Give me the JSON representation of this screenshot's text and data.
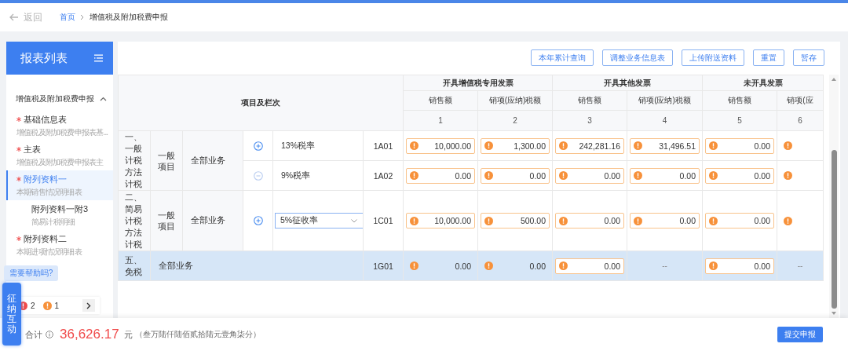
{
  "header": {
    "back": "返回",
    "breadcrumb": [
      {
        "label": "首页",
        "link": true
      },
      {
        "label": "增值税及附加税费申报",
        "link": false
      }
    ]
  },
  "sidebar": {
    "title": "报表列表",
    "group": {
      "label": "增值税及附加税费申报",
      "expanded": true,
      "items": [
        {
          "title": "基础信息表",
          "subtitle": "增值税及附加税费申报表基...",
          "required": true,
          "selected": false
        },
        {
          "title": "主表",
          "subtitle": "增值税及附加税费申报表主",
          "required": true,
          "selected": false
        },
        {
          "title": "附列资料一",
          "subtitle": "本期销售情况明细表",
          "required": true,
          "selected": true,
          "children": [
            {
              "title": "附列资料一附3",
              "subtitle": "简易计税明细",
              "required": false,
              "selected": false
            }
          ]
        },
        {
          "title": "附列资料二",
          "subtitle": "本期进项情况明细表",
          "required": true,
          "selected": false
        }
      ]
    }
  },
  "toolbar": {
    "buttons": [
      "本年累计查询",
      "调整业务信息表",
      "上传附送资料",
      "重置",
      "暂存"
    ]
  },
  "table": {
    "stub_header": "项目及栏次",
    "groups": [
      {
        "title": "开具增值税专用发票",
        "columns": [
          {
            "label": "销售额",
            "number": "1"
          },
          {
            "label": "销项(应纳)税额",
            "number": "2"
          }
        ]
      },
      {
        "title": "开具其他发票",
        "columns": [
          {
            "label": "销售额",
            "number": "3"
          },
          {
            "label": "销项(应纳)税额",
            "number": "4"
          }
        ]
      },
      {
        "title": "未开具发票",
        "columns": [
          {
            "label": "销售额",
            "number": "5"
          },
          {
            "label": "销项(应",
            "number": "6"
          }
        ]
      }
    ],
    "sections": [
      {
        "title": "一、一般计税方法计税",
        "item": "一般项目",
        "scope": "全部业务",
        "lines": [
          {
            "toggle": {
              "kind": "add"
            },
            "rate": {
              "kind": "text",
              "value": "13%税率"
            },
            "code": "1A01",
            "selected": false,
            "cells": [
              {
                "kind": "input",
                "value": "10,000.00"
              },
              {
                "kind": "input",
                "value": "1,300.00"
              },
              {
                "kind": "input",
                "value": "242,281.16"
              },
              {
                "kind": "input",
                "value": "31,496.51"
              },
              {
                "kind": "input",
                "value": "0.00"
              },
              {
                "kind": "marker"
              }
            ]
          },
          {
            "toggle": {
              "kind": "remove"
            },
            "rate": {
              "kind": "text",
              "value": "9%税率"
            },
            "code": "1A02",
            "selected": false,
            "cells": [
              {
                "kind": "input",
                "value": "0.00"
              },
              {
                "kind": "input",
                "value": "0.00"
              },
              {
                "kind": "input",
                "value": "0.00"
              },
              {
                "kind": "input",
                "value": "0.00"
              },
              {
                "kind": "input",
                "value": "0.00"
              },
              {
                "kind": "marker"
              }
            ]
          }
        ]
      },
      {
        "title": "二、简易计税方法计税",
        "item": "一般项目",
        "scope": "全部业务",
        "lines": [
          {
            "toggle": {
              "kind": "add"
            },
            "rate": {
              "kind": "select",
              "value": "5%征收率"
            },
            "code": "1C01",
            "selected": false,
            "cells": [
              {
                "kind": "input",
                "value": "10,000.00"
              },
              {
                "kind": "input",
                "value": "500.00"
              },
              {
                "kind": "input",
                "value": "0.00"
              },
              {
                "kind": "input",
                "value": "0.00"
              },
              {
                "kind": "input",
                "value": "0.00"
              },
              {
                "kind": "marker"
              }
            ]
          }
        ]
      },
      {
        "title": "五、免税",
        "scope": "全部业务",
        "lines": [
          {
            "code": "1G01",
            "selected": true,
            "cells": [
              {
                "kind": "flag",
                "value": "0.00"
              },
              {
                "kind": "flag",
                "value": "0.00"
              },
              {
                "kind": "input",
                "value": "0.00"
              },
              {
                "kind": "text",
                "value": "--"
              },
              {
                "kind": "input",
                "value": "0.00"
              },
              {
                "kind": "text",
                "value": "--"
              }
            ]
          }
        ]
      }
    ]
  },
  "help_tip": "需要帮助吗?",
  "chat_button": "征纳互动",
  "issues": [
    {
      "kind": "error",
      "count": "2"
    },
    {
      "kind": "warning",
      "count": "1"
    }
  ],
  "footer": {
    "total_label": "合计",
    "total": "36,626.17",
    "unit": "元",
    "total_words": "（叁万陆仟陆佰贰拾陆元壹角柒分）",
    "submit": "提交申报"
  }
}
